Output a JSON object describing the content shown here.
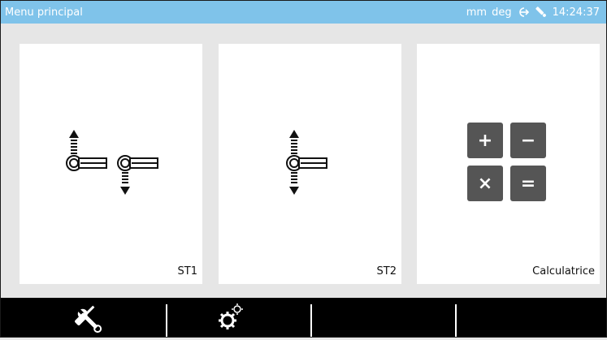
{
  "titlebar": {
    "title": "Menu principal",
    "units_length": "mm",
    "units_angle": "deg",
    "login_icon": "login-arrow-icon",
    "probe_icon": "probe-icon",
    "time": "14:24:37"
  },
  "tiles": [
    {
      "label": "ST1",
      "icon": "two-probes-icon"
    },
    {
      "label": "ST2",
      "icon": "single-probe-icon"
    },
    {
      "label": "Calculatrice",
      "icon": "calculator-icon",
      "keys": [
        "+",
        "−",
        "×",
        "="
      ]
    }
  ],
  "toolbar": {
    "buttons": [
      {
        "icon": "tools-icon"
      },
      {
        "icon": "settings-gears-icon"
      },
      {
        "icon": ""
      },
      {
        "icon": ""
      }
    ]
  },
  "colors": {
    "titlebar": "#7fc3ea",
    "background": "#e6e6e6",
    "tile": "#ffffff",
    "bottombar": "#000000",
    "calc_key": "#555555"
  }
}
